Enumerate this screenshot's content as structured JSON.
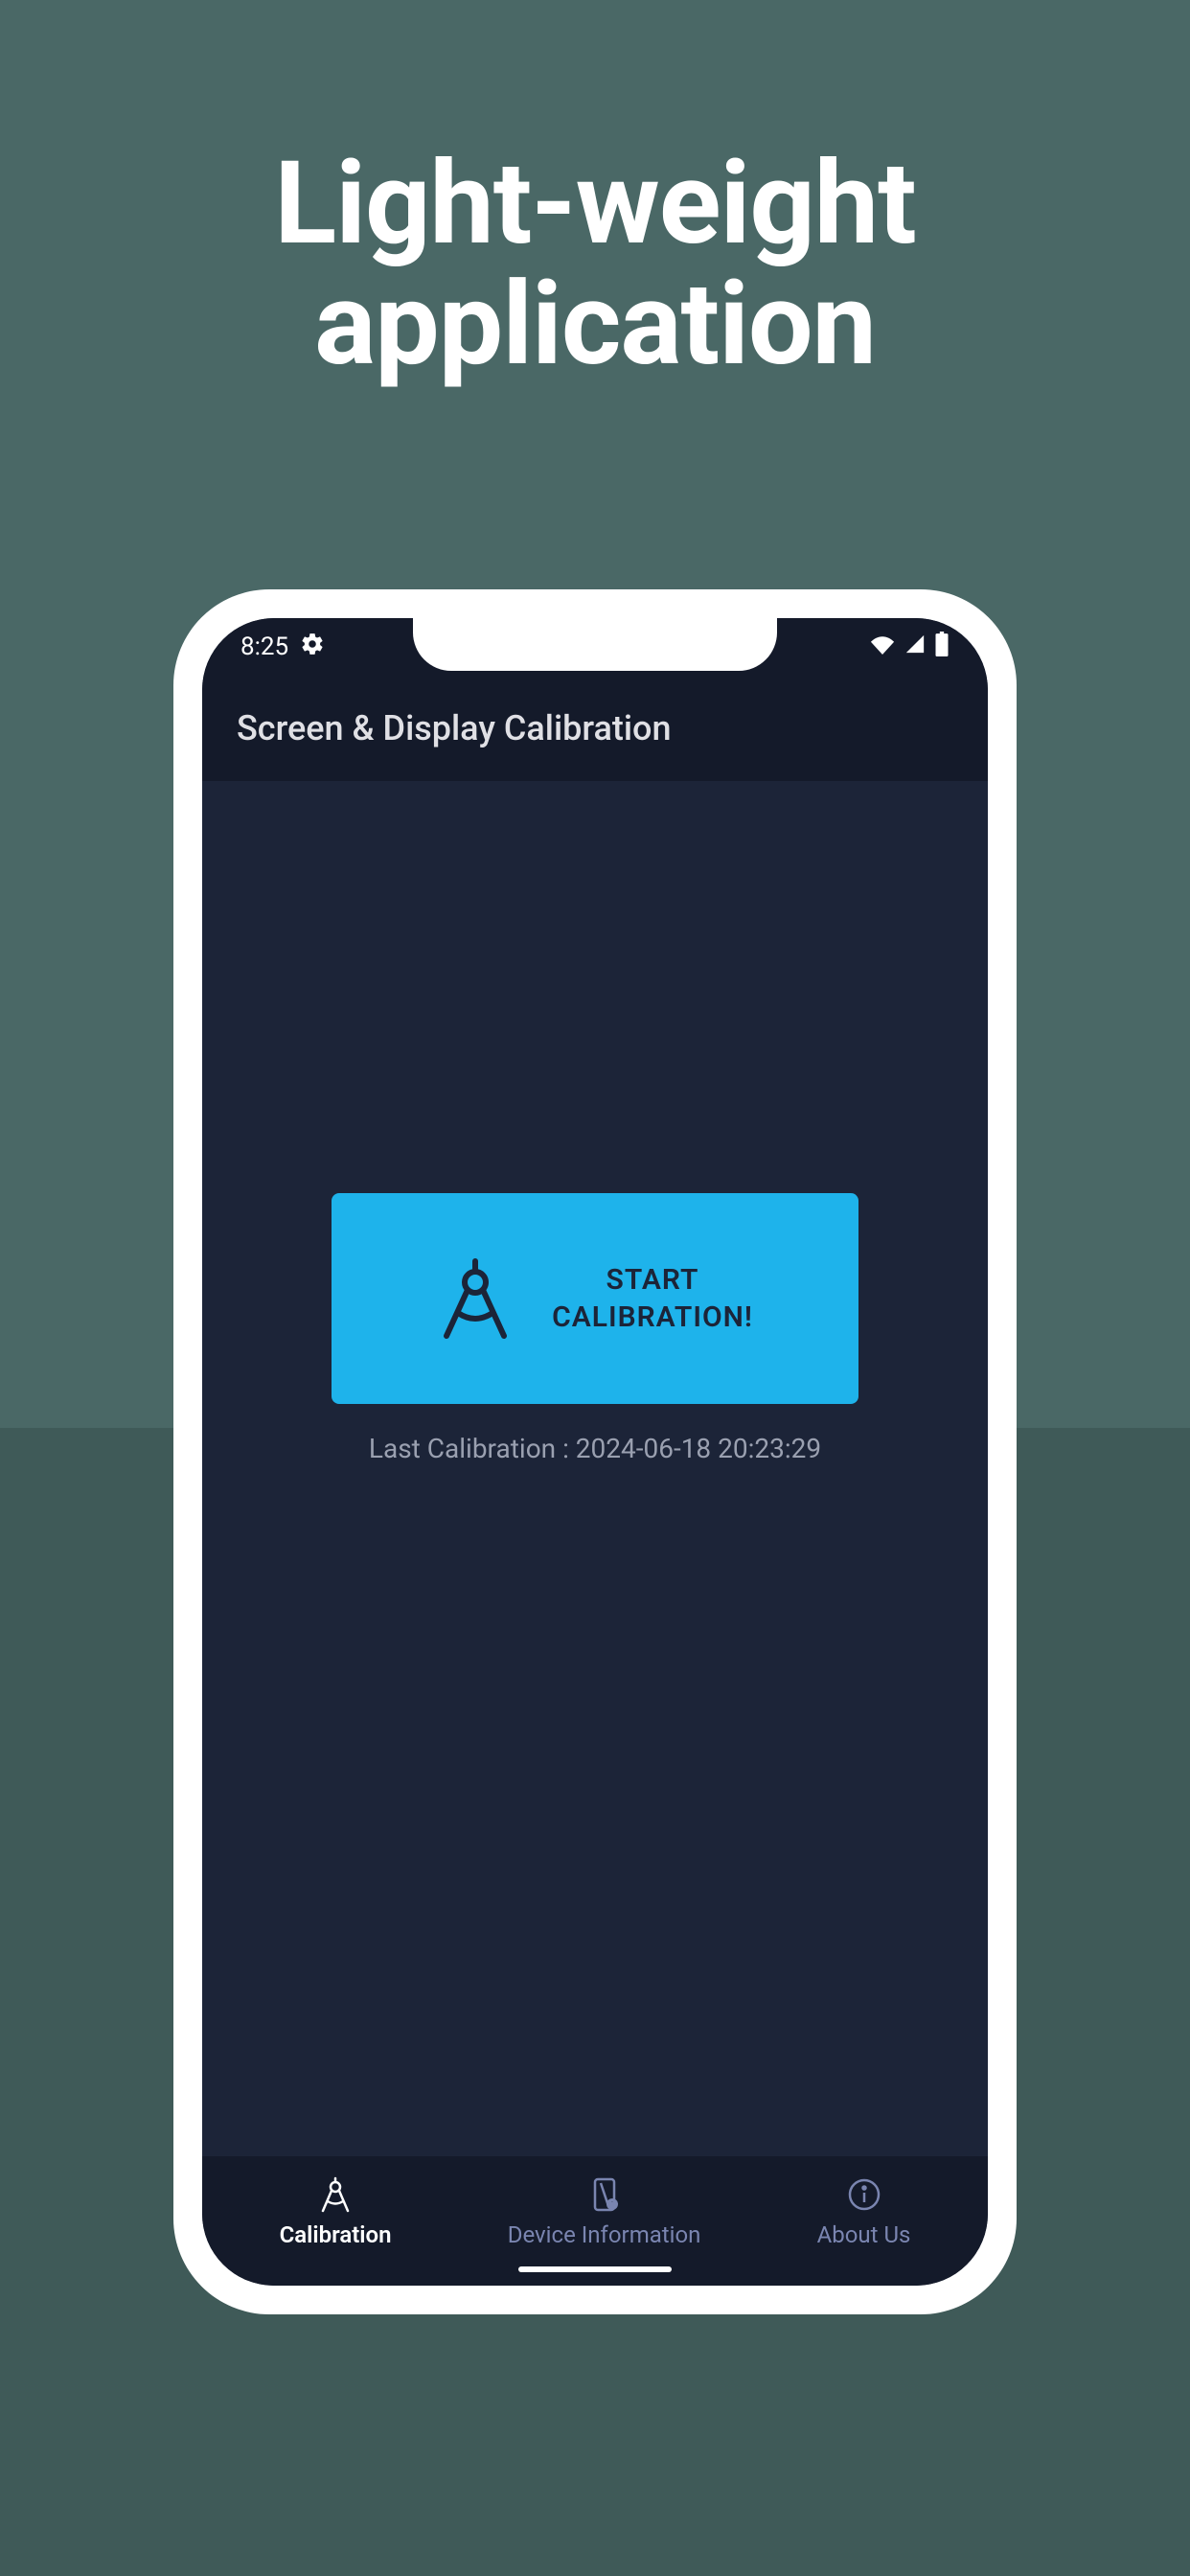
{
  "headline_line1": "Light-weight",
  "headline_line2": "application",
  "status_bar": {
    "time": "8:25"
  },
  "app": {
    "title": "Screen & Display Calibration"
  },
  "main": {
    "button_line1": "START",
    "button_line2": "CALIBRATION!",
    "last_calibration": "Last Calibration : 2024-06-18 20:23:29"
  },
  "nav": {
    "items": [
      {
        "label": "Calibration"
      },
      {
        "label": "Device Information"
      },
      {
        "label": "About Us"
      }
    ]
  },
  "colors": {
    "background": "#4a6866",
    "background_darker": "#3f5a58",
    "phone_screen": "#1c2438",
    "header_bg": "#141a2a",
    "accent": "#1eb3eb",
    "text_muted": "#9aa0b0",
    "nav_inactive": "#7a85b0"
  }
}
